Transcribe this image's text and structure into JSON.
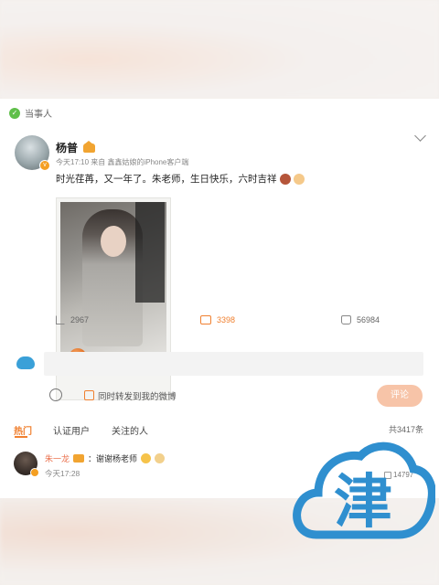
{
  "post": {
    "parties_label": "当事人",
    "author": "杨普",
    "meta": "今天17:10  来自 鑫鑫姑娘的iPhone客户端",
    "text": "时光荏苒，又一年了。朱老师，生日快乐，六时吉祥",
    "stats": {
      "reposts": "2967",
      "comments": "3398",
      "likes": "56984"
    }
  },
  "reply": {
    "input_placeholder": "",
    "forward_label": "同时转发到我的微博",
    "submit_label": "评论"
  },
  "tabs": {
    "hot": "热门",
    "verified": "认证用户",
    "followed": "关注的人",
    "total": "共3417条"
  },
  "comments": [
    {
      "name": "朱一龙",
      "text": "：谢谢杨老师",
      "time": "今天17:28",
      "likes": "14797"
    }
  ],
  "watermark": {
    "char": "津",
    "color": "#2f8fcf"
  },
  "colors": {
    "accent": "#f08030",
    "verified_badge": "#f49f22",
    "submit_button": "#f7c4a8"
  }
}
